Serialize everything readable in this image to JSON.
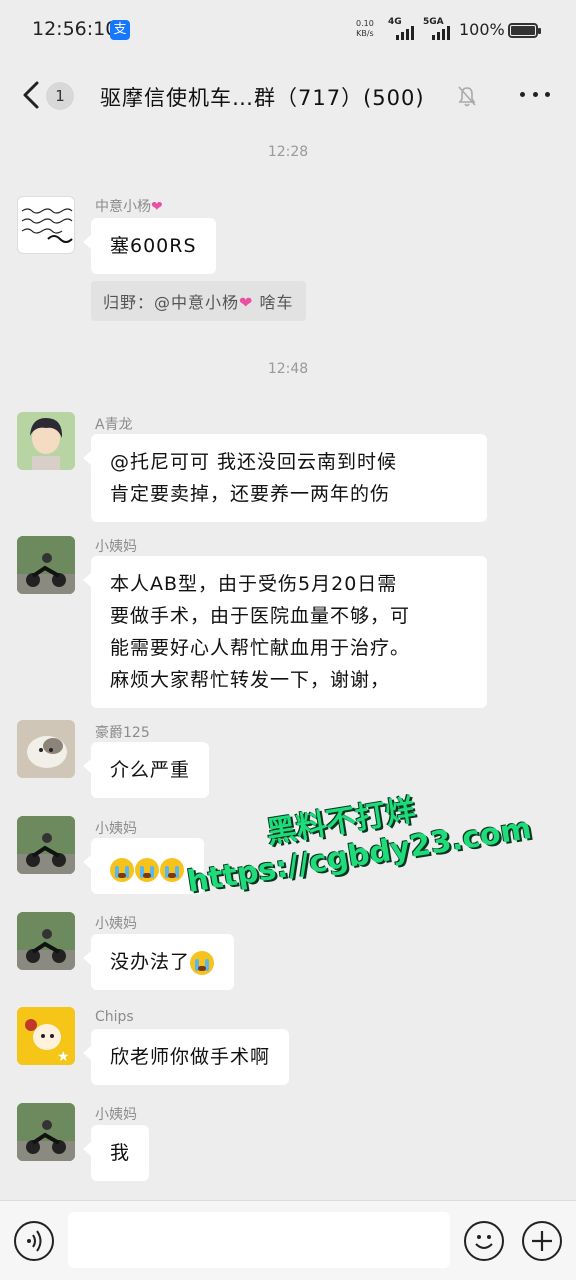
{
  "status": {
    "time": "12:56:10",
    "alipay_glyph": "支",
    "net_speed": "0.10",
    "net_unit": "KB/s",
    "sig1": "4G",
    "sig2": "5GA",
    "battery": "100%",
    "battery_level": 1.0
  },
  "header": {
    "unread": "1",
    "title": "驱摩信使机车…群（717）(500)"
  },
  "messages": {
    "ts1": "12:28",
    "m1_nick": "中意小杨",
    "m1_text": "塞600RS",
    "m1_avatar_text": "世界以痛吻我 我却报之以歌 男人的 小杨",
    "quote_text_a": "归野：@中意小杨",
    "quote_text_b": " 啥车",
    "ts2": "12:48",
    "m2_nick": "A青龙",
    "m2_line1": "@托尼可可  我还没回云南到时候",
    "m2_line2": "肯定要卖掉，还要养一两年的伤",
    "m3_nick": "小姨妈",
    "m3_line1": "本人AB型，由于受伤5月20日需",
    "m3_line2": "要做手术，由于医院血量不够，可",
    "m3_line3": "能需要好心人帮忙献血用于治疗。",
    "m3_line4": "麻烦大家帮忙转发一下，谢谢，",
    "m4_nick": "豪爵125",
    "m4_text": "介么严重",
    "m5_nick": "小姨妈",
    "m6_nick": "小姨妈",
    "m6_text": "没办法了",
    "m7_nick": "Chips",
    "m7_text": "欣老师你做手术啊",
    "m8_nick": "小姨妈",
    "m8_text": "我"
  },
  "watermark": {
    "line1": "黑料不打烊",
    "line2": "https://cgbdy23.com"
  },
  "icons": {
    "back": "chevron-left-icon",
    "mute": "bell-off-icon",
    "more": "more-dots-icon",
    "voice": "voice-icon",
    "emoji": "emoji-icon",
    "plus": "plus-icon"
  }
}
